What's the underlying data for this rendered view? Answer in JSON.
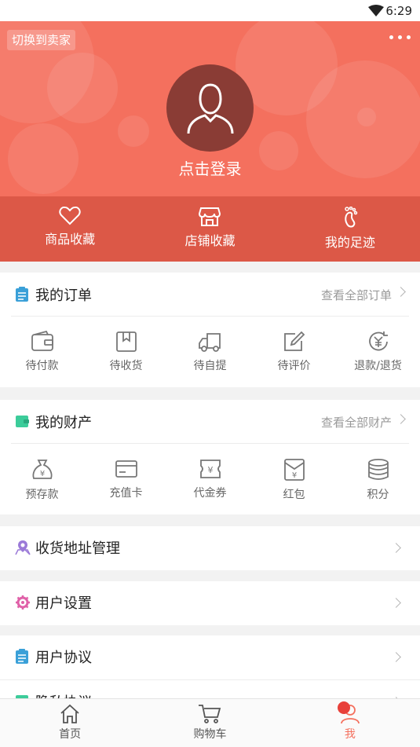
{
  "status_bar": {
    "time": "6:29"
  },
  "header": {
    "switch_label": "切换到卖家",
    "login_text": "点击登录",
    "favorites": [
      {
        "label": "商品收藏",
        "icon": "heart-icon"
      },
      {
        "label": "店铺收藏",
        "icon": "store-icon"
      },
      {
        "label": "我的足迹",
        "icon": "footprint-icon"
      }
    ]
  },
  "orders": {
    "title": "我的订单",
    "link": "查看全部订单",
    "items": [
      {
        "label": "待付款",
        "icon": "wallet-icon"
      },
      {
        "label": "待收货",
        "icon": "box-icon"
      },
      {
        "label": "待自提",
        "icon": "truck-icon"
      },
      {
        "label": "待评价",
        "icon": "edit-icon"
      },
      {
        "label": "退款/退货",
        "icon": "refund-icon"
      }
    ]
  },
  "assets": {
    "title": "我的财产",
    "link": "查看全部财产",
    "items": [
      {
        "label": "预存款",
        "icon": "money-bag-icon"
      },
      {
        "label": "充值卡",
        "icon": "card-icon"
      },
      {
        "label": "代金券",
        "icon": "voucher-icon"
      },
      {
        "label": "红包",
        "icon": "red-envelope-icon"
      },
      {
        "label": "积分",
        "icon": "coins-icon"
      }
    ]
  },
  "menu": [
    {
      "label": "收货地址管理",
      "icon": "location-icon"
    },
    {
      "label": "用户设置",
      "icon": "settings-icon"
    },
    {
      "label": "用户协议",
      "icon": "agreement-icon"
    },
    {
      "label": "隐私协议",
      "icon": "privacy-icon"
    }
  ],
  "tabbar": [
    {
      "label": "首页",
      "icon": "home-icon"
    },
    {
      "label": "购物车",
      "icon": "cart-icon"
    },
    {
      "label": "我",
      "icon": "user-icon"
    }
  ],
  "colors": {
    "brand": "#f4705e",
    "order_icon": "#3aa0d8",
    "asset_icon": "#3ccc9a",
    "address_icon": "#9b7ad8",
    "settings_icon": "#e060a8"
  }
}
